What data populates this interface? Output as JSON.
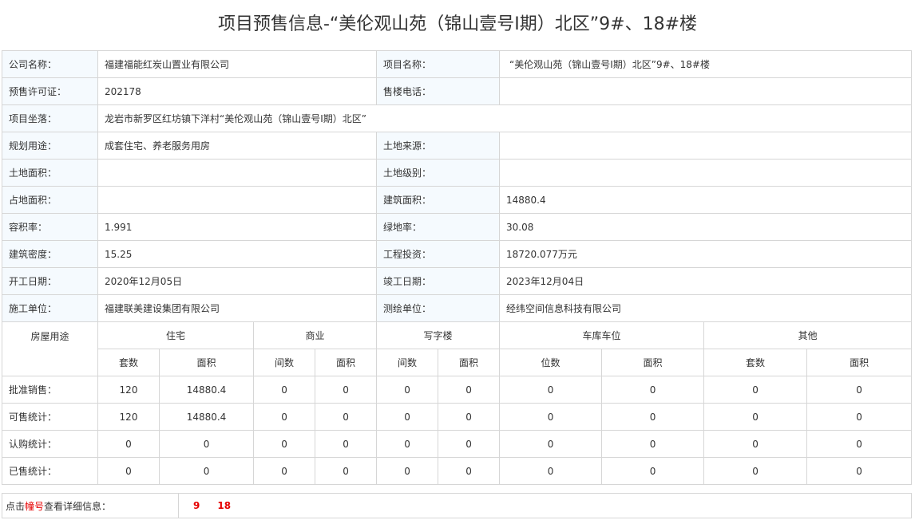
{
  "page_title": "项目预售信息-“美伦观山苑（锦山壹号Ⅰ期）北区”9#、18#楼",
  "info": {
    "company_label": "公司名称：",
    "company_value": "福建福能红炭山置业有限公司",
    "project_label": "项目名称：",
    "project_value": "“美伦观山苑（锦山壹号Ⅰ期）北区”9#、18#楼",
    "permit_label": "预售许可证：",
    "permit_value": "202178",
    "phone_label": "售楼电话：",
    "phone_value": "",
    "location_label": "项目坐落：",
    "location_value": "龙岩市新罗区红坊镇下洋村“美伦观山苑（锦山壹号Ⅰ期）北区”",
    "usage_label": "规划用途：",
    "usage_value": "成套住宅、养老服务用房",
    "land_source_label": "土地来源：",
    "land_source_value": "",
    "land_area_label": "土地面积：",
    "land_area_value": "",
    "land_grade_label": "土地级别：",
    "land_grade_value": "",
    "occupied_area_label": "占地面积：",
    "occupied_area_value": "",
    "build_area_label": "建筑面积：",
    "build_area_value": "14880.4",
    "plot_ratio_label": "容积率：",
    "plot_ratio_value": "1.991",
    "green_ratio_label": "绿地率：",
    "green_ratio_value": "30.08",
    "density_label": "建筑密度：",
    "density_value": "15.25",
    "investment_label": "工程投资：",
    "investment_value": "18720.077万元",
    "start_label": "开工日期：",
    "start_value": "2020年12月05日",
    "finish_label": "竣工日期：",
    "finish_value": "2023年12月04日",
    "contractor_label": "施工单位：",
    "contractor_value": "福建联美建设集团有限公司",
    "surveyor_label": "测绘单位：",
    "surveyor_value": "经纬空间信息科技有限公司"
  },
  "stats": {
    "house_use_label": "房屋用途",
    "groups": [
      "住宅",
      "商业",
      "写字楼",
      "车库车位",
      "其他"
    ],
    "subheaders": [
      "套数",
      "面积",
      "间数",
      "面积",
      "间数",
      "面积",
      "位数",
      "面积",
      "套数",
      "面积"
    ],
    "rows": [
      {
        "label": "批准销售：",
        "values": [
          "120",
          "14880.4",
          "0",
          "0",
          "0",
          "0",
          "0",
          "0",
          "0",
          "0"
        ]
      },
      {
        "label": "可售统计：",
        "values": [
          "120",
          "14880.4",
          "0",
          "0",
          "0",
          "0",
          "0",
          "0",
          "0",
          "0"
        ]
      },
      {
        "label": "认购统计：",
        "values": [
          "0",
          "0",
          "0",
          "0",
          "0",
          "0",
          "0",
          "0",
          "0",
          "0"
        ]
      },
      {
        "label": "已售统计：",
        "values": [
          "0",
          "0",
          "0",
          "0",
          "0",
          "0",
          "0",
          "0",
          "0",
          "0"
        ]
      }
    ]
  },
  "footer": {
    "prefix": "点击",
    "highlight": "幢号",
    "suffix": "查看详细信息：",
    "buildings": [
      "9",
      "18"
    ]
  }
}
